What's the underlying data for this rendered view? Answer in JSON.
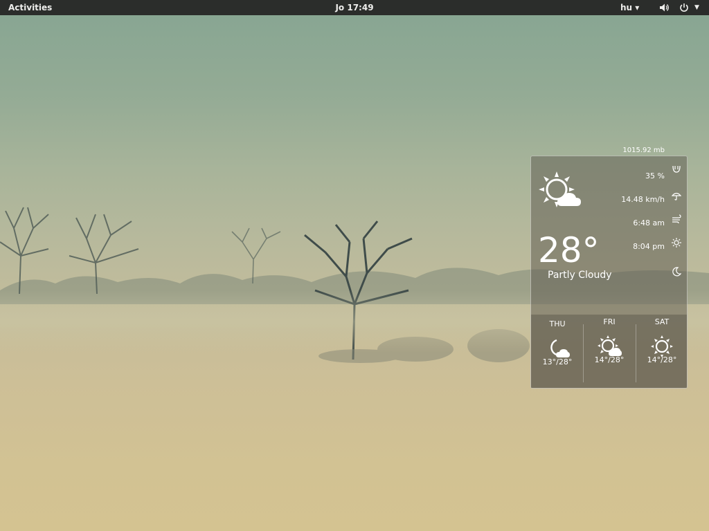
{
  "topbar": {
    "activities": "Activities",
    "clock": "Jo 17:49",
    "language": "hu ▾",
    "icons": [
      "volume-icon",
      "power-icon",
      "chevron-down-icon"
    ]
  },
  "weather": {
    "pressure": "1015.92 mb",
    "temperature": "28°",
    "condition": "Partly Cloudy",
    "condition_icon": "partly-cloudy-icon",
    "humidity": "35 %",
    "wind": "14.48 km/h",
    "sunrise": "6:48 am",
    "sunset": "8:04 pm",
    "stat_icons": [
      "humidity-icon",
      "umbrella-icon",
      "wind-icon",
      "sun-icon",
      "moon-icon"
    ],
    "forecast": [
      {
        "day": "THU",
        "temp": "13°/28°",
        "icon": "moon-cloud-icon"
      },
      {
        "day": "FRI",
        "temp": "14°/28°",
        "icon": "partly-cloudy-icon"
      },
      {
        "day": "SAT",
        "temp": "14°/28°",
        "icon": "sun-icon"
      }
    ]
  },
  "colors": {
    "topbar": "#2b2d2b",
    "sky_top": "#86a592",
    "field": "#d4c391",
    "widget_bg": "rgba(95,92,82,0.52)"
  }
}
